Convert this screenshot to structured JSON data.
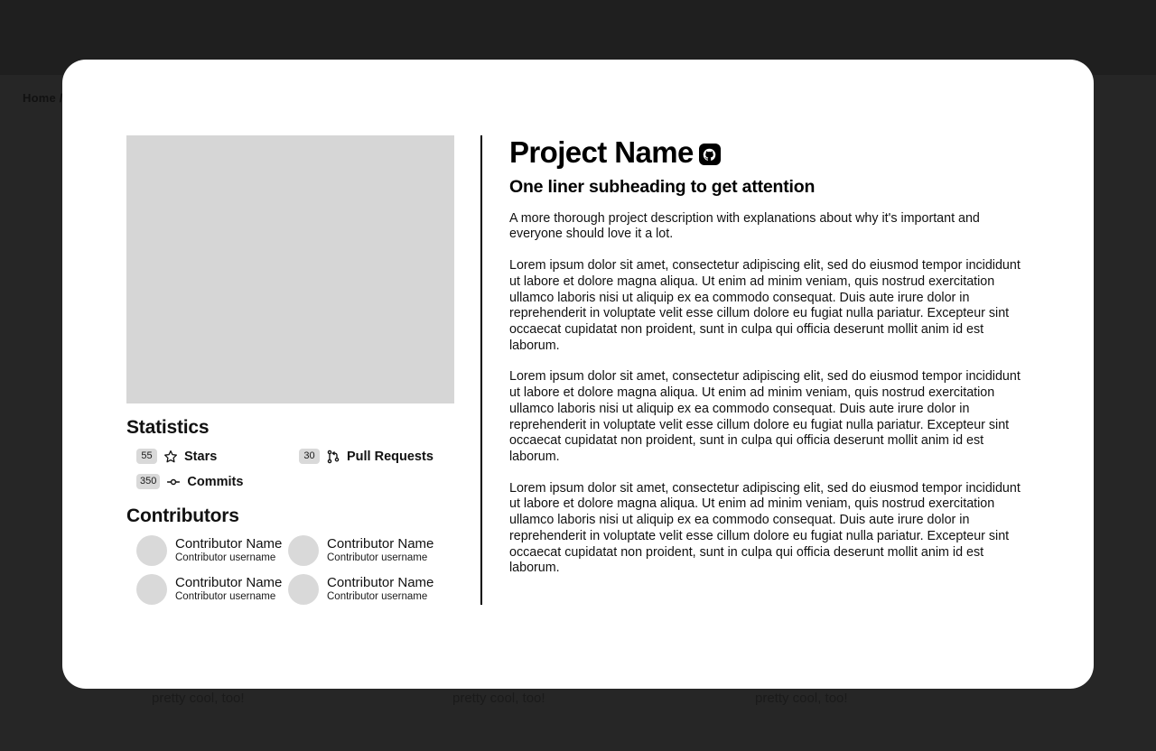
{
  "backdrop": {
    "breadcrumb": "Home /",
    "card_notes": [
      "pretty cool, too!",
      "pretty cool, too!",
      "pretty cool, too!"
    ],
    "colors": {
      "top_band": "#1f1f1f",
      "lower_band": "#262626",
      "note_text": "#1a1a1a"
    }
  },
  "modal": {
    "left": {
      "image_placeholder_name": "project-image-placeholder",
      "statistics": {
        "heading": "Statistics",
        "items": [
          {
            "count": "55",
            "icon": "star-icon",
            "label": "Stars"
          },
          {
            "count": "30",
            "icon": "pull-request-icon",
            "label": "Pull Requests"
          },
          {
            "count": "350",
            "icon": "commit-icon",
            "label": "Commits"
          }
        ]
      },
      "contributors": {
        "heading": "Contributors",
        "items": [
          {
            "name": "Contributor Name",
            "username": "Contributor username"
          },
          {
            "name": "Contributor Name",
            "username": "Contributor username"
          },
          {
            "name": "Contributor Name",
            "username": "Contributor username"
          },
          {
            "name": "Contributor Name",
            "username": "Contributor username"
          }
        ]
      }
    },
    "right": {
      "title": "Project Name",
      "badge_icon": "github-icon",
      "subheading": "One liner subheading to get attention",
      "description": "A more thorough project description with explanations about why it's important and everyone should love it a lot.",
      "paragraphs": [
        "Lorem ipsum dolor sit amet, consectetur adipiscing elit, sed do eiusmod tempor incididunt ut labore et dolore magna aliqua. Ut enim ad minim veniam, quis nostrud exercitation ullamco laboris nisi ut aliquip ex ea commodo consequat. Duis aute irure dolor in reprehenderit in voluptate velit esse cillum dolore eu fugiat nulla pariatur. Excepteur sint occaecat cupidatat non proident, sunt in culpa qui officia deserunt mollit anim id est laborum.",
        "Lorem ipsum dolor sit amet, consectetur adipiscing elit, sed do eiusmod tempor incididunt ut labore et dolore magna aliqua. Ut enim ad minim veniam, quis nostrud exercitation ullamco laboris nisi ut aliquip ex ea commodo consequat. Duis aute irure dolor in reprehenderit in voluptate velit esse cillum dolore eu fugiat nulla pariatur. Excepteur sint occaecat cupidatat non proident, sunt in culpa qui officia deserunt mollit anim id est laborum.",
        "Lorem ipsum dolor sit amet, consectetur adipiscing elit, sed do eiusmod tempor incididunt ut labore et dolore magna aliqua. Ut enim ad minim veniam, quis nostrud exercitation ullamco laboris nisi ut aliquip ex ea commodo consequat. Duis aute irure dolor in reprehenderit in voluptate velit esse cillum dolore eu fugiat nulla pariatur. Excepteur sint occaecat cupidatat non proident, sunt in culpa qui officia deserunt mollit anim id est laborum."
      ]
    },
    "colors": {
      "surface": "#ffffff",
      "divider": "#000000",
      "placeholder": "#d6d6d6",
      "badge_bg": "#d9d9d9"
    }
  }
}
